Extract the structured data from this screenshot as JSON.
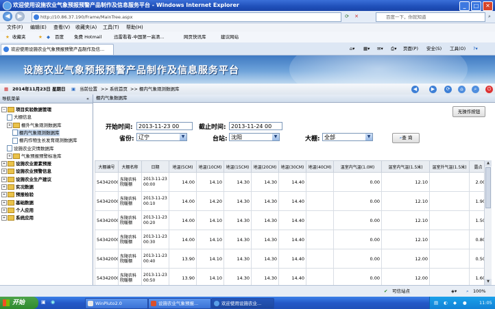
{
  "window": {
    "title": "欢迎使用设施农业气象预报预警产品制作及信息服务平台 - Windows Internet Explorer"
  },
  "addressbar": {
    "url": "http://10.86.37.190/Frame/MainTree.aspx",
    "search_placeholder": "百度一下，你就知道"
  },
  "menubar": {
    "items": [
      "文件(F)",
      "编辑(E)",
      "查看(V)",
      "收藏夹(A)",
      "工具(T)",
      "帮助(H)"
    ]
  },
  "favbar": {
    "favorites": "收藏夹",
    "items": [
      "百度",
      "免费 Hotmail",
      "迅雷看看-中国第一高清...",
      "网页快讯库",
      "建议网站"
    ]
  },
  "tab": {
    "title": "欢迎使用设施农业气象预报预警产品制作及信..."
  },
  "tab_tools": {
    "page": "页面(P)",
    "safety": "安全(S)",
    "tools": "工具(O)"
  },
  "banner": {
    "title": "设施农业气象预报预警产品制作及信息服务平台"
  },
  "infobar": {
    "date": "2014年11月23日 星期日",
    "location_label": "当前位置",
    "crumb1": ">> 系统首页",
    "crumb2": ">> 棚内气象观测数据库"
  },
  "sidebar": {
    "header": "导航菜单",
    "items": [
      {
        "label": "项目实验数据管理",
        "level": 0,
        "bold": true,
        "type": "folder",
        "expander": "−"
      },
      {
        "label": "大棚信息",
        "level": 1,
        "type": "page"
      },
      {
        "label": "棚外气象观测数据库",
        "level": 1,
        "type": "folder",
        "expander": "+"
      },
      {
        "label": "棚内气象观测数据库",
        "level": 2,
        "type": "page",
        "selected": true
      },
      {
        "label": "棚内作物生长发育观测数据库",
        "level": 2,
        "type": "page"
      },
      {
        "label": "设施农业灾情数据库",
        "level": 1,
        "type": "page"
      },
      {
        "label": "气象预报预警标准库",
        "level": 1,
        "type": "folder",
        "expander": "+"
      },
      {
        "label": "设施农业要素预报",
        "level": 0,
        "bold": true,
        "type": "folder",
        "expander": "+"
      },
      {
        "label": "设施农业预警信息",
        "level": 0,
        "bold": true,
        "type": "folder",
        "expander": "+"
      },
      {
        "label": "设施农业生产建议",
        "level": 0,
        "bold": true,
        "type": "folder",
        "expander": "+"
      },
      {
        "label": "实况数据",
        "level": 0,
        "bold": true,
        "type": "folder",
        "expander": "+"
      },
      {
        "label": "预报检验",
        "level": 0,
        "bold": true,
        "type": "folder",
        "expander": "+"
      },
      {
        "label": "基础数据",
        "level": 0,
        "bold": true,
        "type": "folder",
        "expander": "+"
      },
      {
        "label": "个人应用",
        "level": 0,
        "bold": true,
        "type": "folder",
        "expander": "+"
      },
      {
        "label": "系统应用",
        "level": 0,
        "bold": true,
        "type": "folder",
        "expander": "+"
      }
    ]
  },
  "panel": {
    "title": "棚内气象数据库",
    "export_button": "无操作按钮"
  },
  "filters": {
    "start_label": "开始时间:",
    "start_value": "2013-11-23 00",
    "end_label": "截止时间:",
    "end_value": "2013-11-24 00",
    "province_label": "省份:",
    "province_value": "辽宁",
    "station_label": "台站:",
    "station_value": "沈阳",
    "greenhouse_label": "大棚:",
    "greenhouse_value": "全部",
    "query_button": "查 询"
  },
  "table": {
    "columns": [
      "大棚编号",
      "大棚名称",
      "日期",
      "地温(5CM)",
      "地温(10CM)",
      "地温(15CM)",
      "地温(20CM)",
      "地温(30CM)",
      "地温(40CM)",
      "温室内气温(1.0M)",
      "温室内气温(1.5米)",
      "温室外气温(1.5米)",
      "露点"
    ],
    "rows": [
      [
        "54342000",
        "东陵农科院暖棚",
        "2013-11-23 00:00",
        "14.00",
        "14.10",
        "14.30",
        "14.30",
        "14.40",
        "",
        "0.00",
        "12.10",
        "",
        "2.00"
      ],
      [
        "54342000",
        "东陵农科院暖棚",
        "2013-11-23 00:10",
        "14.00",
        "14.20",
        "14.30",
        "14.30",
        "14.40",
        "",
        "0.00",
        "12.10",
        "",
        "1.90"
      ],
      [
        "54342000",
        "东陵农科院暖棚",
        "2013-11-23 00:20",
        "14.00",
        "14.10",
        "14.30",
        "14.30",
        "14.40",
        "",
        "0.00",
        "12.10",
        "",
        "1.50"
      ],
      [
        "54342000",
        "东陵农科院暖棚",
        "2013-11-23 00:30",
        "14.00",
        "14.10",
        "14.30",
        "14.30",
        "14.40",
        "",
        "0.00",
        "12.10",
        "",
        "0.80"
      ],
      [
        "54342000",
        "东陵农科院暖棚",
        "2013-11-23 00:40",
        "13.90",
        "14.10",
        "14.30",
        "14.30",
        "14.40",
        "",
        "0.00",
        "12.00",
        "",
        "0.50"
      ],
      [
        "54342000",
        "东陵农科院暖棚",
        "2013-11-23 00:50",
        "13.90",
        "14.10",
        "14.30",
        "14.30",
        "14.40",
        "",
        "0.00",
        "12.00",
        "",
        "1.60"
      ]
    ]
  },
  "statusbar": {
    "zone": "可信站点",
    "zoom": "100%"
  },
  "taskbar": {
    "start": "开始",
    "items": [
      "WinPluto2.0",
      "设施农业气象预报...",
      "欢迎使用设施农业..."
    ],
    "clock": "11:05"
  }
}
